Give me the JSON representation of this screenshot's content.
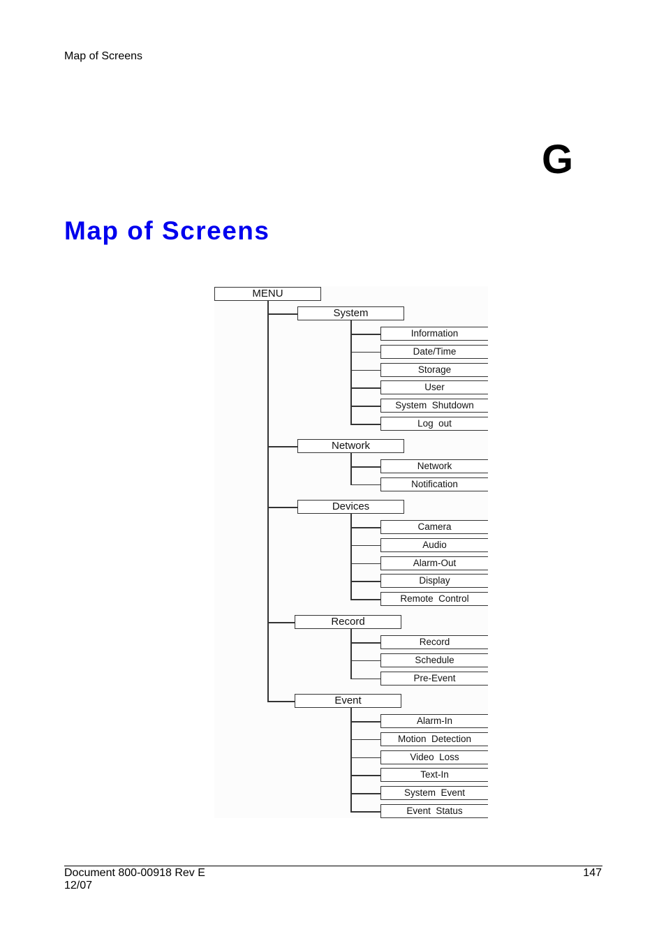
{
  "header": {
    "running_title": "Map of Screens",
    "chapter_letter": "G"
  },
  "page_title": "Map of Screens",
  "menu_tree": {
    "root": "MENU",
    "categories": [
      {
        "label": "System",
        "items": [
          "Information",
          "Date/Time",
          "Storage",
          "User",
          "System  Shutdown",
          "Log  out"
        ]
      },
      {
        "label": "Network",
        "items": [
          "Network",
          "Notification"
        ]
      },
      {
        "label": "Devices",
        "items": [
          "Camera",
          "Audio",
          "Alarm-Out",
          "Display",
          "Remote  Control"
        ]
      },
      {
        "label": "Record",
        "items": [
          "Record",
          "Schedule",
          "Pre-Event"
        ]
      },
      {
        "label": "Event",
        "items": [
          "Alarm-In",
          "Motion  Detection",
          "Video  Loss",
          "Text-In",
          "System  Event",
          "Event  Status"
        ]
      }
    ]
  },
  "footer": {
    "document": "Document 800-00918 Rev E",
    "date": "12/07",
    "page_number": "147"
  }
}
